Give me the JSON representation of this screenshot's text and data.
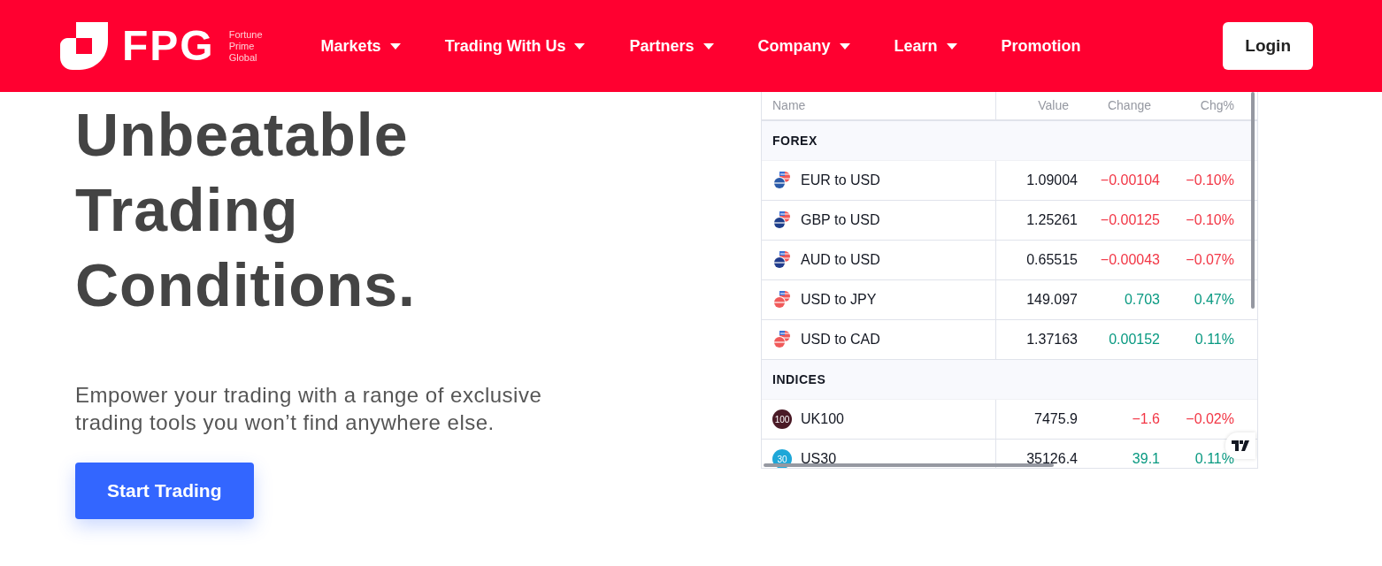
{
  "navbar": {
    "logo": {
      "wordmark": "FPG",
      "tagline": [
        "Fortune",
        "Prime",
        "Global"
      ]
    },
    "items": [
      {
        "label": "Markets",
        "dropdown": true
      },
      {
        "label": "Trading With Us",
        "dropdown": true
      },
      {
        "label": "Partners",
        "dropdown": true
      },
      {
        "label": "Company",
        "dropdown": true
      },
      {
        "label": "Learn",
        "dropdown": true
      },
      {
        "label": "Promotion",
        "dropdown": false
      }
    ],
    "login": "Login"
  },
  "hero": {
    "heading": [
      "Unbeatable",
      "Trading",
      "Conditions."
    ],
    "text": "Empower your trading with a range of exclusive trading tools you won’t find anywhere else.",
    "button": "Start Trading"
  },
  "widget": {
    "columns": [
      "Name",
      "Value",
      "Change",
      "Chg%"
    ],
    "groups": [
      {
        "title": "FOREX",
        "rows": [
          {
            "kind": "pair",
            "color": "#2a5aa8",
            "name": "EUR to USD",
            "value": "1.09004",
            "change": "−0.00104",
            "pct": "−0.10%",
            "rising": false
          },
          {
            "kind": "pair",
            "color": "#1f3f8a",
            "name": "GBP to USD",
            "value": "1.25261",
            "change": "−0.00125",
            "pct": "−0.10%",
            "rising": false
          },
          {
            "kind": "pair",
            "color": "#213c8c",
            "name": "AUD to USD",
            "value": "0.65515",
            "change": "−0.00043",
            "pct": "−0.07%",
            "rising": false
          },
          {
            "kind": "pair",
            "color": "#f05a5a",
            "name": "USD to JPY",
            "value": "149.097",
            "change": "0.703",
            "pct": "0.47%",
            "rising": true
          },
          {
            "kind": "pair",
            "color": "#f05a5a",
            "name": "USD to CAD",
            "value": "1.37163",
            "change": "0.00152",
            "pct": "0.11%",
            "rising": true
          }
        ]
      },
      {
        "title": "INDICES",
        "rows": [
          {
            "kind": "index",
            "color": "#4a1a26",
            "badge": "100",
            "name": "UK100",
            "value": "7475.9",
            "change": "−1.6",
            "pct": "−0.02%",
            "rising": false
          },
          {
            "kind": "index",
            "color": "#1ea7d8",
            "badge": "30",
            "name": "US30",
            "value": "35126.4",
            "change": "39.1",
            "pct": "0.11%",
            "rising": true
          }
        ]
      }
    ]
  }
}
